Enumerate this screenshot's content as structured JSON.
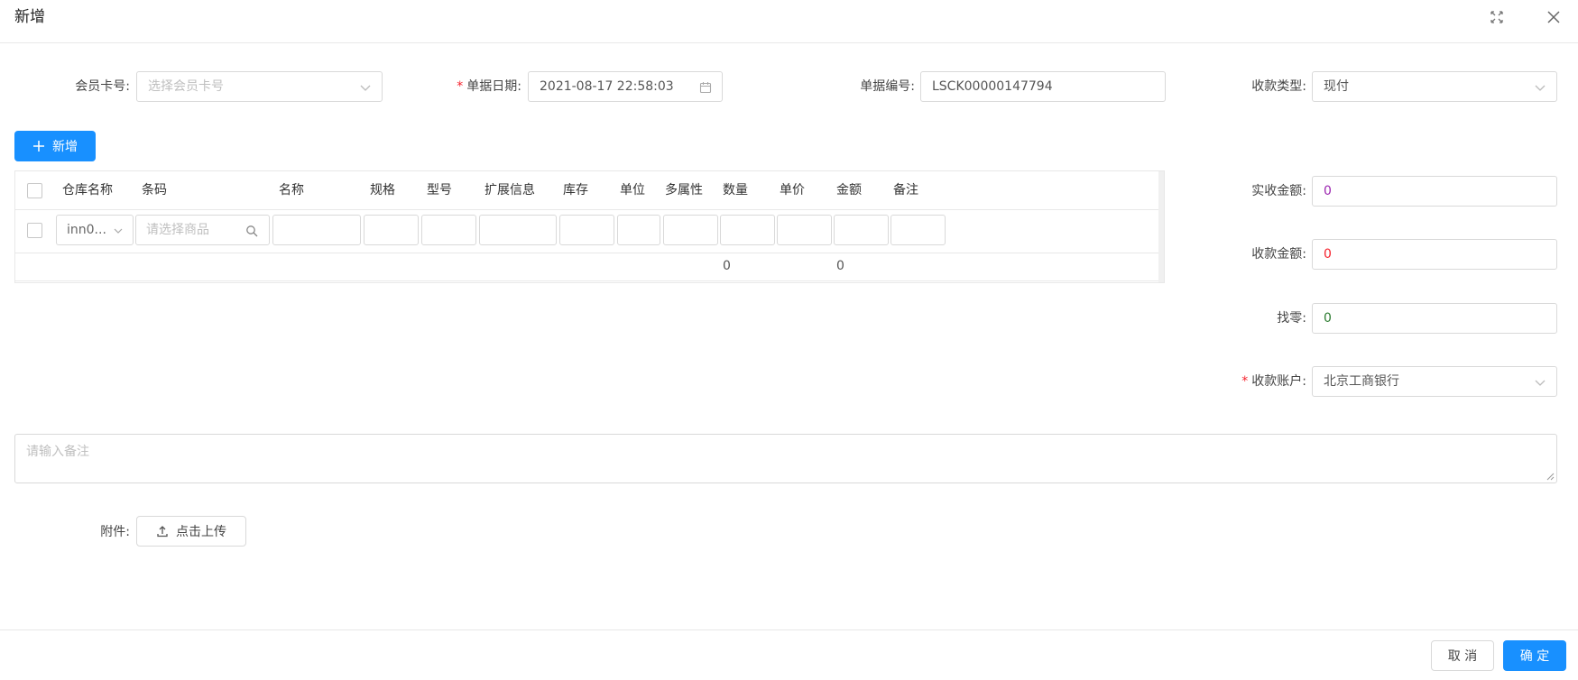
{
  "dialog": {
    "title": "新增"
  },
  "form": {
    "member_card": {
      "label": "会员卡号:",
      "placeholder": "选择会员卡号"
    },
    "doc_date": {
      "required_mark": "*",
      "label": "单据日期:",
      "value": "2021-08-17 22:58:03"
    },
    "doc_no": {
      "label": "单据编号:",
      "value": "LSCK00000147794"
    },
    "payment_type": {
      "label": "收款类型:",
      "value": "现付"
    },
    "add_button": {
      "label": "新增"
    },
    "actual_amount": {
      "label": "实收金额:",
      "value": "0"
    },
    "receive_amount": {
      "label": "收款金额:",
      "value": "0"
    },
    "change": {
      "label": "找零:",
      "value": "0"
    },
    "account": {
      "required_mark": "*",
      "label": "收款账户:",
      "value": "北京工商银行"
    },
    "remark": {
      "placeholder": "请输入备注"
    },
    "attachment": {
      "label": "附件:",
      "upload_label": "点击上传"
    }
  },
  "table": {
    "columns": [
      "仓库名称",
      "条码",
      "名称",
      "规格",
      "型号",
      "扩展信息",
      "库存",
      "单位",
      "多属性",
      "数量",
      "单价",
      "金额",
      "备注"
    ],
    "row": {
      "warehouse": "inn0...",
      "product_placeholder": "请选择商品"
    },
    "summary": {
      "quantity_total": "0",
      "amount_total": "0"
    }
  },
  "footer": {
    "cancel_label": "取 消",
    "ok_label": "确 定"
  },
  "colors": {
    "primary": "#1890ff",
    "required": "#f5222d",
    "actual": "#9c27b0",
    "receive": "#f5222d",
    "change": "#2e7d32"
  }
}
